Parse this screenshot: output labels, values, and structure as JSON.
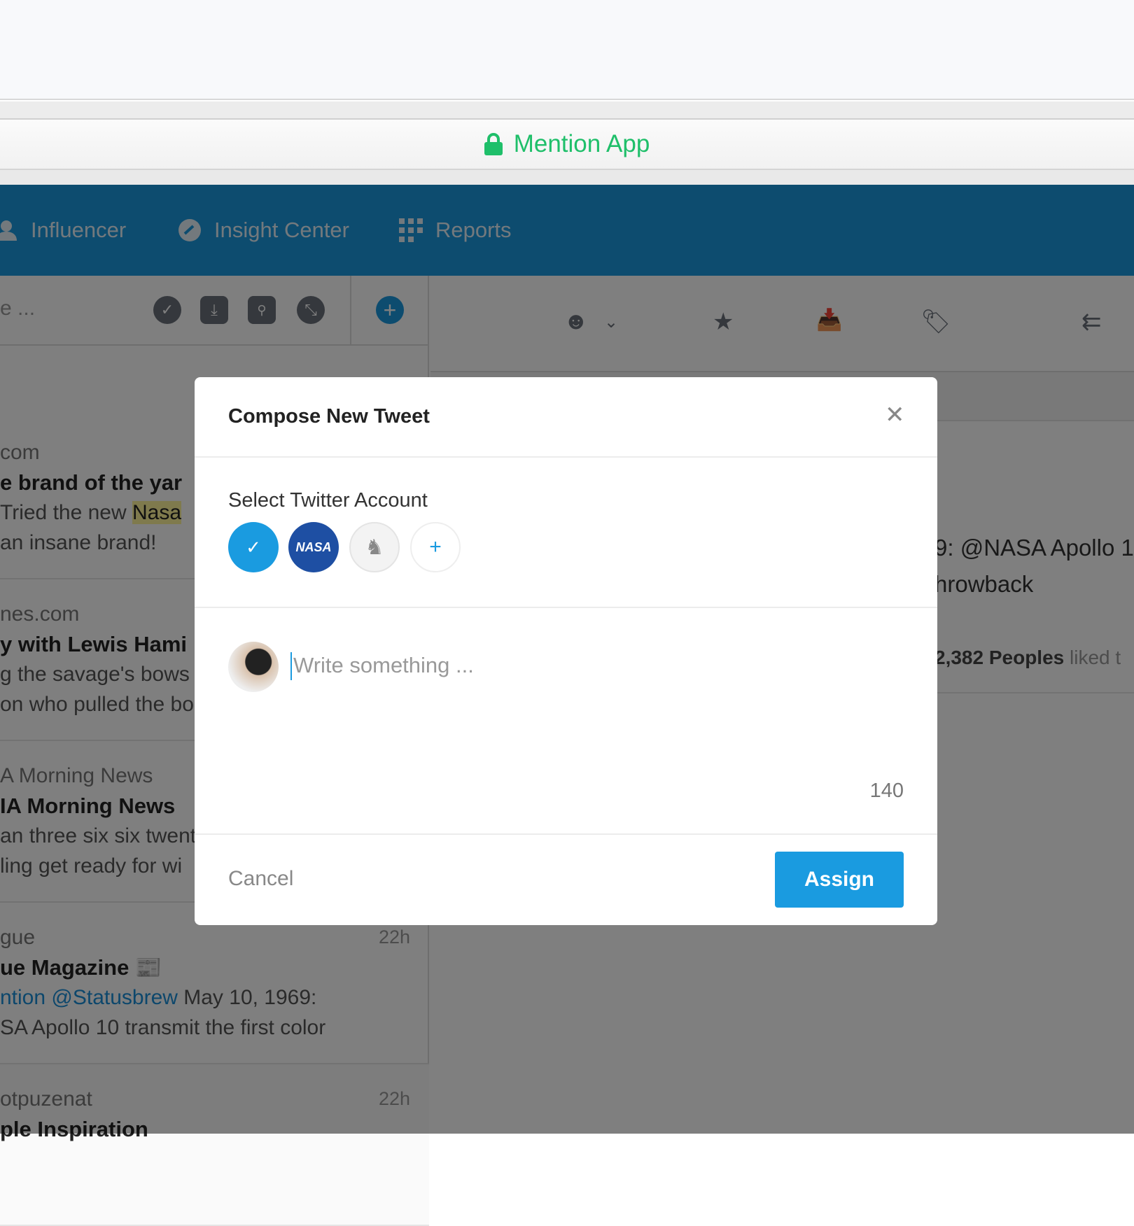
{
  "browser": {
    "title": "Mention App",
    "lock_icon": "lock-icon"
  },
  "nav": {
    "items": [
      {
        "label": "Influencer",
        "icon": "user-icon"
      },
      {
        "label": "Insight Center",
        "icon": "gauge-icon"
      },
      {
        "label": "Reports",
        "icon": "grid-icon"
      }
    ]
  },
  "left_toolbar": {
    "search_placeholder": "e ...",
    "icons": [
      "check-circle-icon",
      "download-icon",
      "filter-icon",
      "compress-icon"
    ],
    "add_icon": "plus-circle-icon"
  },
  "list": [
    {
      "source": "com",
      "title": "e brand of the yar",
      "line1_pre": "Tried the new ",
      "highlight": "Nasa",
      "line2": "an insane brand!",
      "time": ""
    },
    {
      "source": "nes.com",
      "title": "y with Lewis Hami",
      "line1": "g the savage's bows",
      "line2": "on who pulled the bo",
      "time": ""
    },
    {
      "source": "A Morning News",
      "title": "IA Morning News",
      "line1": "an three six six twent",
      "line2": "ling get ready for wi",
      "time": ""
    },
    {
      "source": "gue",
      "title": "ue Magazine 📰",
      "line1_link": "ntion @Statusbrew",
      "line1_rest": " May 10, 1969:",
      "line2": "SA Apollo 10 transmit the first color",
      "time": "22h"
    },
    {
      "source": "otpuzenat",
      "title": "ple Inspiration",
      "time": "22h"
    }
  ],
  "right": {
    "icons": [
      "smiley-icon",
      "chevron-down-icon",
      "star-icon",
      "inbox-icon",
      "tag-icon",
      "reply-all-icon"
    ],
    "text1": "9: @NASA Apollo 1",
    "text2": "hrowback",
    "likes_count": "2,382 Peoples",
    "likes_rest": " liked t"
  },
  "modal": {
    "title": "Compose New Tweet",
    "section_label": "Select Twitter Account",
    "accounts": [
      {
        "name": "selected",
        "selected": true
      },
      {
        "name": "NASA",
        "label": "NASA"
      },
      {
        "name": "burberry"
      }
    ],
    "add_account": "+",
    "placeholder": "Write something ...",
    "char_count": "140",
    "cancel": "Cancel",
    "assign": "Assign",
    "accent": "#1a9be0"
  }
}
